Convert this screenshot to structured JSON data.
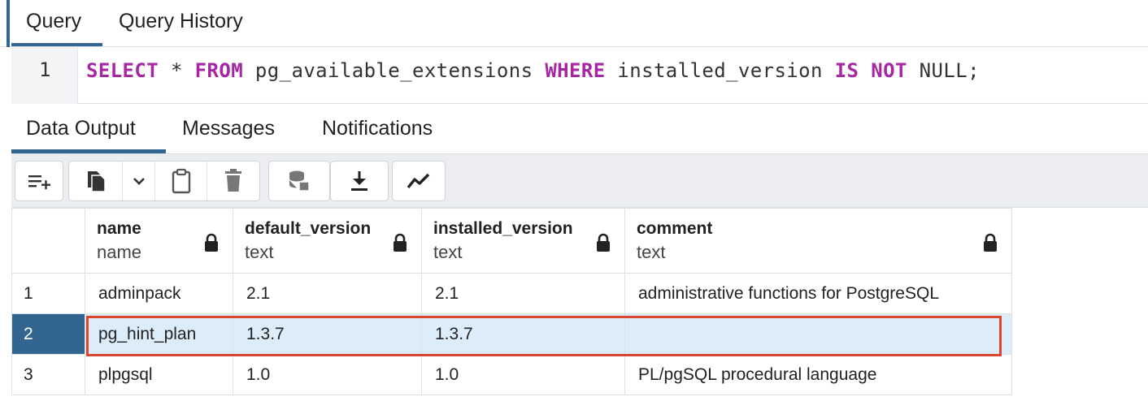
{
  "top_tabs": [
    {
      "label": "Query"
    },
    {
      "label": "Query History"
    }
  ],
  "editor": {
    "line_number": "1",
    "tokens": {
      "select": "SELECT",
      "star": " * ",
      "from": "FROM",
      "table": " pg_available_extensions ",
      "where": "WHERE",
      "column": " installed_version ",
      "is": "IS",
      "space": " ",
      "not": "NOT",
      "tail": " NULL;"
    }
  },
  "output_tabs": [
    {
      "label": "Data Output"
    },
    {
      "label": "Messages"
    },
    {
      "label": "Notifications"
    }
  ],
  "toolbar": {
    "icons": [
      "add-row-icon",
      "copy-icon",
      "chevron-down-icon",
      "paste-icon",
      "delete-icon",
      "save-data-icon",
      "download-icon",
      "graph-icon"
    ]
  },
  "grid": {
    "columns": [
      {
        "name": "name",
        "type": "name"
      },
      {
        "name": "default_version",
        "type": "text"
      },
      {
        "name": "installed_version",
        "type": "text"
      },
      {
        "name": "comment",
        "type": "text"
      }
    ],
    "rows": [
      {
        "num": "1",
        "name": "adminpack",
        "default_version": "2.1",
        "installed_version": "2.1",
        "comment": "administrative functions for PostgreSQL"
      },
      {
        "num": "2",
        "name": "pg_hint_plan",
        "default_version": "1.3.7",
        "installed_version": "1.3.7",
        "comment": ""
      },
      {
        "num": "3",
        "name": "plpgsql",
        "default_version": "1.0",
        "installed_version": "1.0",
        "comment": "PL/pgSQL procedural language"
      }
    ],
    "selected_row": 2
  },
  "colors": {
    "accent": "#326690",
    "keyword": "#a626a4",
    "selection": "#dcecf9",
    "highlight_border": "#d9452f"
  }
}
